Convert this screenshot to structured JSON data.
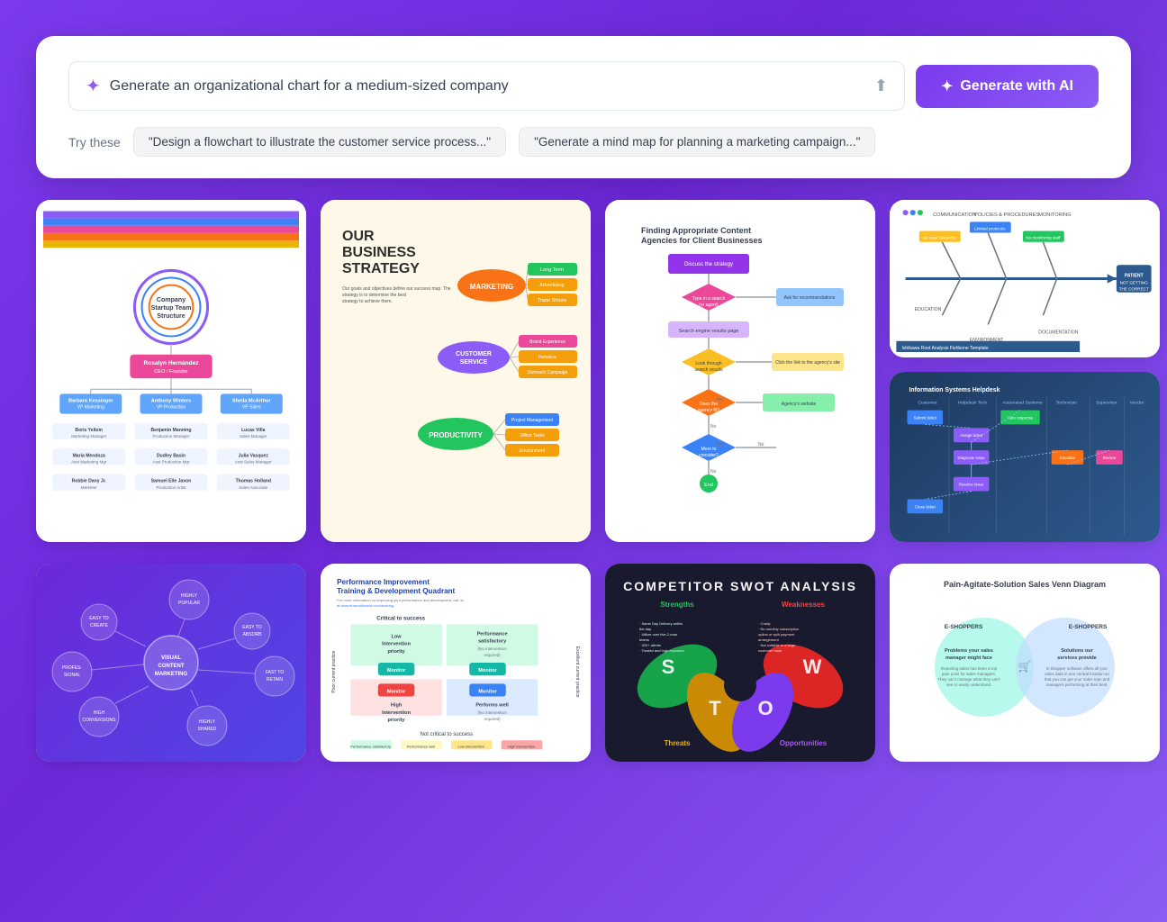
{
  "search": {
    "placeholder": "Generate an organizational chart for a medium-sized company",
    "value": "Generate an organizational chart for a medium-sized company",
    "generate_label": "Generate with AI",
    "sparkle": "✦",
    "upload_symbol": "⬆",
    "try_these_label": "Try these",
    "suggestions": [
      "\"Design a flowchart to illustrate the customer service process...\"",
      "\"Generate a mind map for planning a marketing campaign...\""
    ]
  },
  "gallery": {
    "cards": [
      {
        "id": "org-chart",
        "title": "Company Startup Team Structure",
        "type": "org"
      },
      {
        "id": "business-strategy",
        "title": "Our Business Strategy",
        "type": "strategy"
      },
      {
        "id": "content-flowchart",
        "title": "Finding Appropriate Content Agencies for Client Businesses",
        "type": "flowchart"
      },
      {
        "id": "fishbone",
        "title": "Ishikawa Root Analysis Fishbone Template",
        "type": "fishbone"
      },
      {
        "id": "helpdesk",
        "title": "Information Systems Helpdesk",
        "type": "helpdesk"
      },
      {
        "id": "mindmap",
        "title": "Visual Content Marketing",
        "type": "mindmap"
      },
      {
        "id": "quadrant",
        "title": "Performance Improvement Training & Development Quadrant",
        "type": "quadrant"
      },
      {
        "id": "swot",
        "title": "Competitor SWOT Analysis",
        "type": "swot"
      },
      {
        "id": "venn",
        "title": "Pain-Agitate-Solution Sales Venn Diagram",
        "type": "venn"
      }
    ]
  },
  "colors": {
    "purple": "#7c3aed",
    "light_purple": "#8b5cf6",
    "blue": "#3b82f6",
    "pink": "#ec4899",
    "teal": "#14b8a6",
    "orange": "#f97316",
    "green": "#22c55e",
    "yellow": "#eab308",
    "dark": "#1a1a2e",
    "white": "#ffffff"
  }
}
